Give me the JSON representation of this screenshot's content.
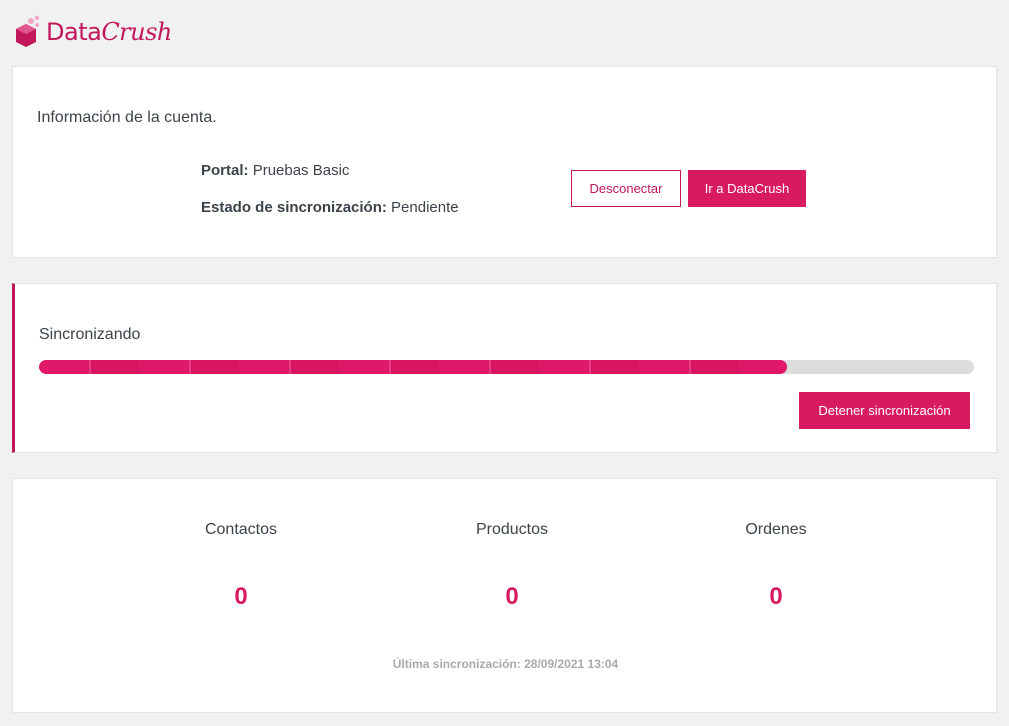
{
  "brand": {
    "name_part1": "Data",
    "name_part2": "Crush",
    "accent_color": "#d81b60"
  },
  "account": {
    "title": "Información de la cuenta.",
    "portal_label": "Portal:",
    "portal_value": "Pruebas Basic",
    "status_label": "Estado de sincronización:",
    "status_value": "Pendiente",
    "disconnect_label": "Desconectar",
    "goto_label": "Ir a DataCrush"
  },
  "sync": {
    "title": "Sincronizando",
    "progress_percent": 80,
    "stop_label": "Detener sincronización"
  },
  "stats": {
    "items": [
      {
        "label": "Contactos",
        "value": "0"
      },
      {
        "label": "Productos",
        "value": "0"
      },
      {
        "label": "Ordenes",
        "value": "0"
      }
    ],
    "last_sync": "Última sincronización: 28/09/2021 13:04"
  }
}
